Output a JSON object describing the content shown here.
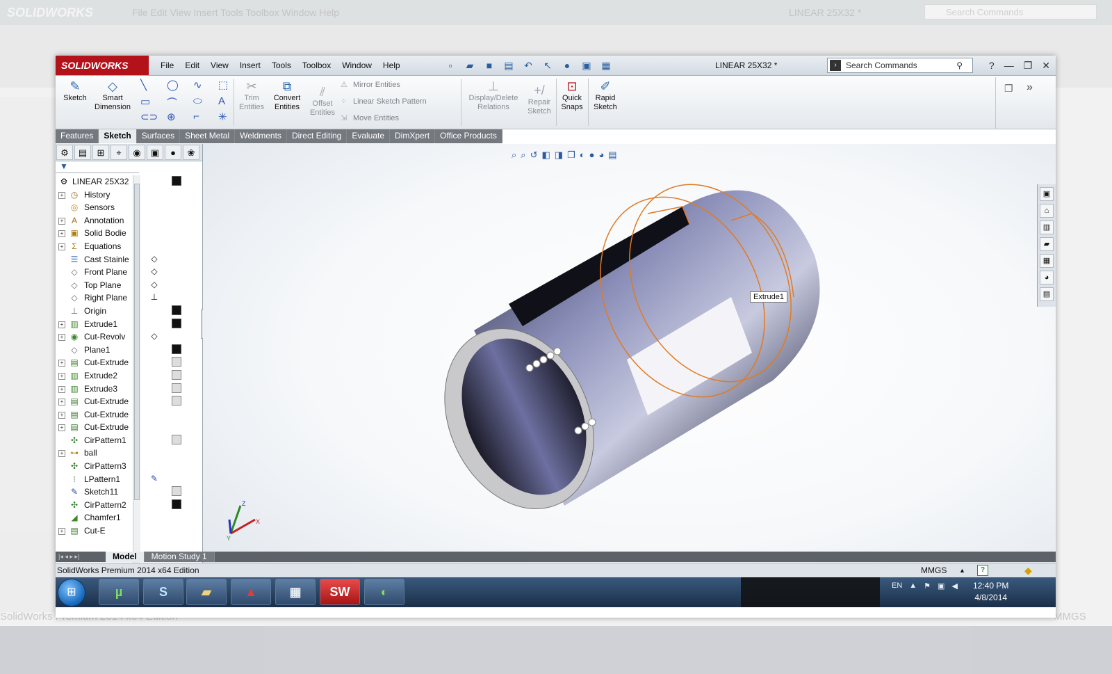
{
  "background": {
    "logo": "SOLIDWORKS",
    "menu": "File   Edit   View   Insert   Tools   Toolbox   Window   Help",
    "doc_title": "LINEAR 25X32 *",
    "search_placeholder": "Search Commands",
    "status_text": "SolidWorks Premium 2014 x64 Edition",
    "units": "MMGS"
  },
  "app": {
    "logo_text": "SOLIDWORKS",
    "doc_title": "LINEAR 25X32 *",
    "search_placeholder": "Search Commands",
    "menu": [
      "File",
      "Edit",
      "View",
      "Insert",
      "Tools",
      "Toolbox",
      "Window",
      "Help"
    ]
  },
  "commands": {
    "sketch": "Sketch",
    "smart_dimension": [
      "Smart",
      "Dimension"
    ],
    "trim_entities": [
      "Trim",
      "Entities"
    ],
    "convert_entities": [
      "Convert",
      "Entities"
    ],
    "offset_entities": [
      "Offset",
      "Entities"
    ],
    "mirror_entities": "Mirror Entities",
    "linear_sketch_pattern": "Linear Sketch Pattern",
    "move_entities": "Move Entities",
    "display_delete_relations": [
      "Display/Delete",
      "Relations"
    ],
    "repair_sketch": [
      "Repair",
      "Sketch"
    ],
    "quick_snaps": [
      "Quick",
      "Snaps"
    ],
    "rapid_sketch": [
      "Rapid",
      "Sketch"
    ]
  },
  "tabs": [
    "Features",
    "Sketch",
    "Surfaces",
    "Sheet Metal",
    "Weldments",
    "Direct Editing",
    "Evaluate",
    "DimXpert",
    "Office Products"
  ],
  "active_tab": "Sketch",
  "tree": {
    "root": "LINEAR 25X32",
    "items": [
      {
        "label": "History",
        "icon": "history-icon",
        "expand": true
      },
      {
        "label": "Sensors",
        "icon": "sensors-icon",
        "expand": false
      },
      {
        "label": "Annotation",
        "icon": "annotations-icon",
        "expand": true
      },
      {
        "label": "Solid Bodie",
        "icon": "solid-bodies-icon",
        "expand": true
      },
      {
        "label": "Equations",
        "icon": "equations-icon",
        "expand": true
      },
      {
        "label": "Cast Stainle",
        "icon": "material-icon",
        "expand": false
      },
      {
        "label": "Front Plane",
        "icon": "plane-icon",
        "expand": false
      },
      {
        "label": "Top Plane",
        "icon": "plane-icon",
        "expand": false
      },
      {
        "label": "Right Plane",
        "icon": "plane-icon",
        "expand": false
      },
      {
        "label": "Origin",
        "icon": "origin-icon",
        "expand": false
      },
      {
        "label": "Extrude1",
        "icon": "extrude-icon",
        "expand": true
      },
      {
        "label": "Cut-Revolv",
        "icon": "cut-revolve-icon",
        "expand": true
      },
      {
        "label": "Plane1",
        "icon": "plane-icon",
        "expand": false
      },
      {
        "label": "Cut-Extrude",
        "icon": "cut-extrude-icon",
        "expand": true
      },
      {
        "label": "Extrude2",
        "icon": "extrude-icon",
        "expand": true
      },
      {
        "label": "Extrude3",
        "icon": "extrude-icon",
        "expand": true
      },
      {
        "label": "Cut-Extrude",
        "icon": "cut-extrude-icon",
        "expand": true
      },
      {
        "label": "Cut-Extrude",
        "icon": "cut-extrude-icon",
        "expand": true
      },
      {
        "label": "Cut-Extrude",
        "icon": "cut-extrude-icon",
        "expand": true
      },
      {
        "label": "CirPattern1",
        "icon": "circular-pattern-icon",
        "expand": false
      },
      {
        "label": "ball",
        "icon": "revolve-icon",
        "expand": true
      },
      {
        "label": "CirPattern3",
        "icon": "circular-pattern-icon",
        "expand": false
      },
      {
        "label": "LPattern1",
        "icon": "linear-pattern-icon",
        "expand": false
      },
      {
        "label": "Sketch11",
        "icon": "sketch-icon",
        "expand": false
      },
      {
        "label": "CirPattern2",
        "icon": "circular-pattern-icon",
        "expand": false
      },
      {
        "label": "Chamfer1",
        "icon": "chamfer-icon",
        "expand": false
      },
      {
        "label": "Cut-E",
        "icon": "cut-extrude-icon",
        "expand": true
      }
    ]
  },
  "viewport": {
    "callout": "Extrude1",
    "triad_labels": [
      "Z",
      "Y",
      "X"
    ],
    "body_colors": {
      "light": "#e8e8f2",
      "mid": "#7b7fa8",
      "dark": "#101018",
      "edge": "#e07a22"
    }
  },
  "bottom_tabs": [
    "Model",
    "Motion Study 1"
  ],
  "active_bottom_tab": "Model",
  "status": {
    "text": "SolidWorks Premium 2014 x64 Edition",
    "units": "MMGS"
  },
  "taskbar": {
    "apps": [
      "uTorrent",
      "Skype",
      "Windows Explorer",
      "Adobe Acrobat",
      "Calculator",
      "SolidWorks",
      "Camtasia"
    ],
    "tray_lang": "EN",
    "time": "12:40 PM",
    "date": "4/8/2014"
  }
}
